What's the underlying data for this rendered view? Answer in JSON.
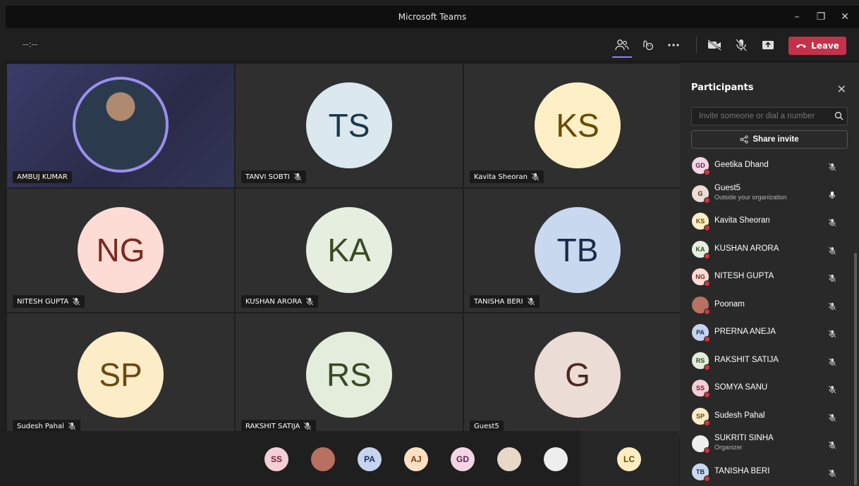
{
  "window": {
    "title": "Microsoft Teams"
  },
  "toolbar": {
    "timer": "--:--",
    "leave_label": "Leave"
  },
  "tiles": [
    {
      "name": "AMBUJ KUMAR",
      "initials": "",
      "bg": "#ffffff",
      "fg": "#ffffff",
      "photo": true,
      "muted": false
    },
    {
      "name": "TANVI SOBTI",
      "initials": "TS",
      "bg": "#dbe8f0",
      "fg": "#1b3a4a",
      "photo": false,
      "muted": true
    },
    {
      "name": "Kavita Sheoran",
      "initials": "KS",
      "bg": "#fdefc6",
      "fg": "#6b4a00",
      "photo": false,
      "muted": true
    },
    {
      "name": "NITESH GUPTA",
      "initials": "NG",
      "bg": "#fddcd6",
      "fg": "#7a2a1a",
      "photo": false,
      "muted": true
    },
    {
      "name": "KUSHAN ARORA",
      "initials": "KA",
      "bg": "#e6efdf",
      "fg": "#3a4a24",
      "photo": false,
      "muted": true
    },
    {
      "name": "TANISHA BERI",
      "initials": "TB",
      "bg": "#c8d8ef",
      "fg": "#1a2a4a",
      "photo": false,
      "muted": true
    },
    {
      "name": "Sudesh Pahal",
      "initials": "SP",
      "bg": "#fdecc8",
      "fg": "#6a4a10",
      "photo": false,
      "muted": true
    },
    {
      "name": "RAKSHIT SATIJA",
      "initials": "RS",
      "bg": "#e4eddc",
      "fg": "#3a4a24",
      "photo": false,
      "muted": true
    },
    {
      "name": "Guest5",
      "initials": "G",
      "bg": "#ecdcd6",
      "fg": "#4a2a20",
      "photo": false,
      "muted": false
    }
  ],
  "strip": [
    {
      "initials": "SS",
      "bg": "#f5cfd6",
      "fg": "#7a2033"
    },
    {
      "initials": "",
      "bg": "#b87060",
      "fg": "#ffffff"
    },
    {
      "initials": "PA",
      "bg": "#c5d5f0",
      "fg": "#1a3366"
    },
    {
      "initials": "AJ",
      "bg": "#fde0c2",
      "fg": "#7a3a10"
    },
    {
      "initials": "GD",
      "bg": "#f2d6e6",
      "fg": "#6a2050"
    },
    {
      "initials": "",
      "bg": "#e8d8c8",
      "fg": "#333333"
    },
    {
      "initials": "",
      "bg": "#eeeeee",
      "fg": "#555555"
    },
    {
      "initials": "LC",
      "bg": "#fdeec2",
      "fg": "#6a4a00"
    }
  ],
  "participants": {
    "title": "Participants",
    "invite_placeholder": "Invite someone or dial a number",
    "share_label": "Share invite",
    "list": [
      {
        "initials": "GD",
        "name": "Geetika Dhand",
        "sub": "",
        "bg": "#f2d6e6",
        "fg": "#6a2050",
        "mic_on": false
      },
      {
        "initials": "G",
        "name": "Guest5",
        "sub": "Outside your organization",
        "bg": "#ecdcd6",
        "fg": "#4a2a20",
        "mic_on": true
      },
      {
        "initials": "KS",
        "name": "Kavita Sheoran",
        "sub": "",
        "bg": "#fdefc6",
        "fg": "#6b4a00",
        "mic_on": false
      },
      {
        "initials": "KA",
        "name": "KUSHAN ARORA",
        "sub": "",
        "bg": "#e6efdf",
        "fg": "#3a4a24",
        "mic_on": false
      },
      {
        "initials": "NG",
        "name": "NITESH GUPTA",
        "sub": "",
        "bg": "#fddcd6",
        "fg": "#7a2a1a",
        "mic_on": false
      },
      {
        "initials": "",
        "name": "Poonam",
        "sub": "",
        "bg": "#b87060",
        "fg": "#ffffff",
        "mic_on": false
      },
      {
        "initials": "PA",
        "name": "PRERNA ANEJA",
        "sub": "",
        "bg": "#c5d5f0",
        "fg": "#1a3366",
        "mic_on": false
      },
      {
        "initials": "RS",
        "name": "RAKSHIT SATIJA",
        "sub": "",
        "bg": "#e4eddc",
        "fg": "#3a4a24",
        "mic_on": false
      },
      {
        "initials": "SS",
        "name": "SOMYA SANU",
        "sub": "",
        "bg": "#f5cfd6",
        "fg": "#7a2033",
        "mic_on": false
      },
      {
        "initials": "SP",
        "name": "Sudesh Pahal",
        "sub": "",
        "bg": "#fdecc8",
        "fg": "#6a4a10",
        "mic_on": false
      },
      {
        "initials": "",
        "name": "SUKRITI SINHA",
        "sub": "Organizer",
        "bg": "#eeeeee",
        "fg": "#555555",
        "mic_on": false
      },
      {
        "initials": "TB",
        "name": "TANISHA BERI",
        "sub": "",
        "bg": "#c8d8ef",
        "fg": "#1a2a4a",
        "mic_on": false
      }
    ]
  }
}
